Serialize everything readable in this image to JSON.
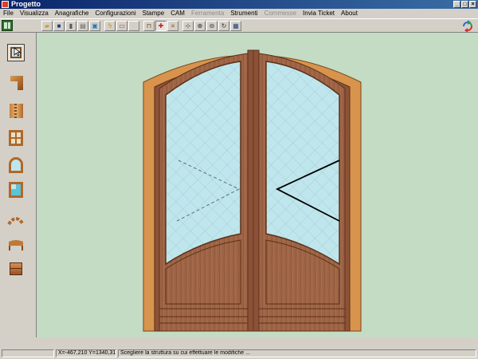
{
  "window": {
    "title": "Progetto"
  },
  "menu": [
    {
      "label": "File",
      "enabled": true
    },
    {
      "label": "Visualizza",
      "enabled": true
    },
    {
      "label": "Anagrafiche",
      "enabled": true
    },
    {
      "label": "Configurazioni",
      "enabled": true
    },
    {
      "label": "Stampe",
      "enabled": true
    },
    {
      "label": "CAM",
      "enabled": true
    },
    {
      "label": "Ferramenta",
      "enabled": false
    },
    {
      "label": "Strumenti",
      "enabled": true
    },
    {
      "label": "Commesse",
      "enabled": false
    },
    {
      "label": "Invia Ticket",
      "enabled": true
    },
    {
      "label": "About",
      "enabled": true
    }
  ],
  "toolbar": {
    "buttons": [
      "open-icon",
      "save-icon",
      "delete-icon",
      "print-icon",
      "preview-icon",
      "lightning-icon",
      "red-frame-icon",
      "blank",
      "frame-tool-icon",
      "active-tool-icon",
      "profile-tool-icon",
      "add-node-icon",
      "zoom-in-icon",
      "zoom-out-icon",
      "rotate-icon",
      "screen-icon"
    ]
  },
  "sidebar": {
    "tools": [
      "select-arrow-icon",
      "profile-corner-icon",
      "joint-icon",
      "window-grid-icon",
      "arch-window-icon",
      "glass-panel-icon",
      "arc-segment-icon",
      "beam-icon",
      "panel-block-icon"
    ]
  },
  "statusbar": {
    "coords": "X=-467,210 Y=1340,310",
    "message": "Scegliere la struttura su cui effettuare le modifiche ..."
  },
  "colors": {
    "canvas": "#c3dcc3",
    "wood": "#9a5e40",
    "glass": "#bfe6ec",
    "title_bar": "#0a246a"
  }
}
